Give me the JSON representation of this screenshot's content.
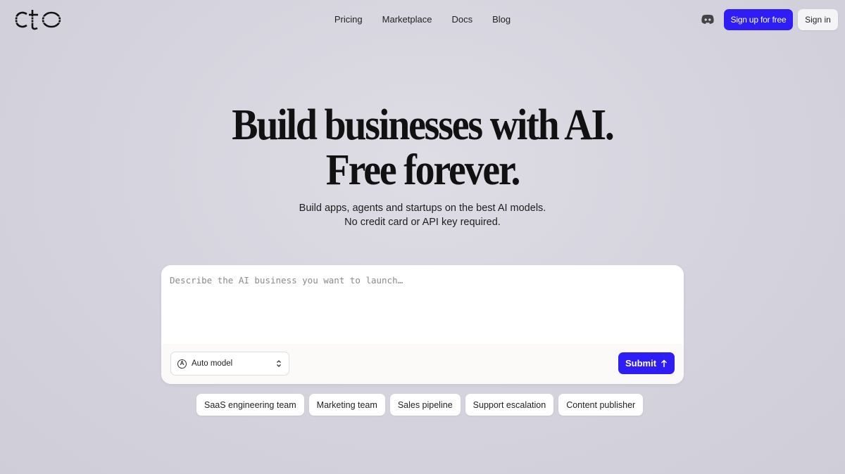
{
  "header": {
    "logo_text": "cto",
    "nav": [
      "Pricing",
      "Marketplace",
      "Docs",
      "Blog"
    ],
    "discord_icon": "discord-icon",
    "signup_label": "Sign up for free",
    "signin_label": "Sign in"
  },
  "hero": {
    "headline_line1": "Build businesses with AI.",
    "headline_line2": "Free forever.",
    "sub_line1": "Build apps, agents and startups on the best AI models.",
    "sub_line2": "No credit card or API key required."
  },
  "prompt": {
    "placeholder": "Describe the AI business you want to launch…",
    "model_label": "Auto model",
    "model_icon": "auto-model-icon",
    "submit_label": "Submit",
    "submit_icon": "arrow-up-icon"
  },
  "suggestions": [
    "SaaS engineering team",
    "Marketing team",
    "Sales pipeline",
    "Support escalation",
    "Content publisher"
  ],
  "colors": {
    "accent": "#2e1ef5",
    "background": "#d6d4de",
    "card": "#ffffff"
  }
}
